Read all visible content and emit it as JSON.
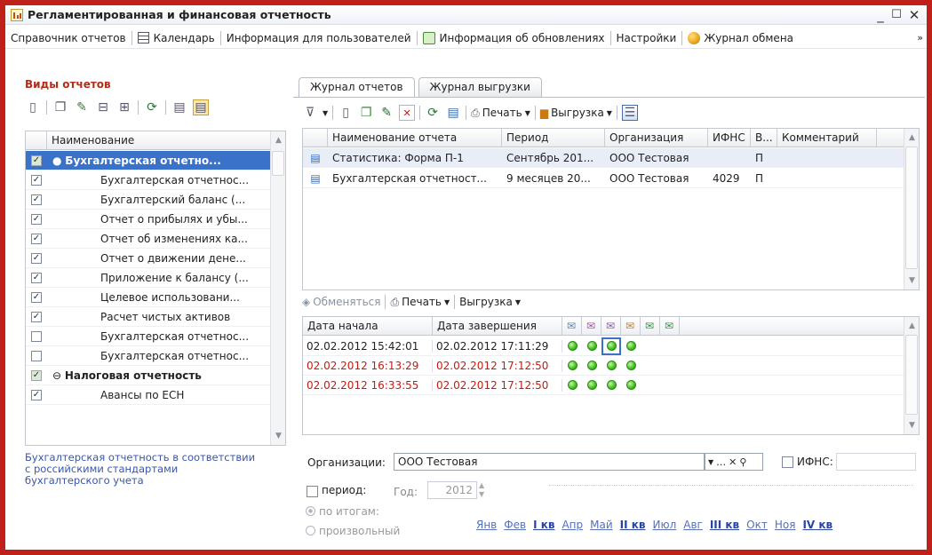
{
  "window": {
    "title": "Регламентированная и финансовая отчетность",
    "min_glyph": "_",
    "close_glyph": "✕"
  },
  "menu": {
    "items": [
      "Справочник отчетов",
      "Календарь",
      "Информация для пользователей",
      "Информация об обновлениях",
      "Настройки",
      "Журнал обмена"
    ],
    "more": "»"
  },
  "left": {
    "title": "Виды отчетов",
    "column": "Наименование",
    "rows": [
      {
        "label": "Бухгалтерская отчетно...",
        "level": 0,
        "checked": true,
        "group": true,
        "selected": true
      },
      {
        "label": "Бухгалтерская отчетнос...",
        "level": 1,
        "checked": true
      },
      {
        "label": "Бухгалтерский баланс (...",
        "level": 1,
        "checked": true
      },
      {
        "label": "Отчет о прибылях и убы...",
        "level": 1,
        "checked": true
      },
      {
        "label": "Отчет об изменениях ка...",
        "level": 1,
        "checked": true
      },
      {
        "label": "Отчет о движении дене...",
        "level": 1,
        "checked": true
      },
      {
        "label": "Приложение к балансу (...",
        "level": 1,
        "checked": true
      },
      {
        "label": "Целевое использовани...",
        "level": 1,
        "checked": true
      },
      {
        "label": "Расчет чистых активов",
        "level": 1,
        "checked": true
      },
      {
        "label": "Бухгалтерская отчетнос...",
        "level": 1,
        "checked": false
      },
      {
        "label": "Бухгалтерская отчетнос...",
        "level": 1,
        "checked": false
      },
      {
        "label": "Налоговая отчетность",
        "level": 0,
        "checked": true,
        "group": true
      },
      {
        "label": "Авансы по ЕСН",
        "level": 1,
        "checked": true
      }
    ],
    "note": "Бухгалтерская отчетность в соответствии с российскими стандартами бухгалтерского учета"
  },
  "tabs": [
    "Журнал отчетов",
    "Журнал выгрузки"
  ],
  "journal": {
    "toolbar": {
      "print": "Печать",
      "export": "Выгрузка"
    },
    "columns": [
      "Наименование отчета",
      "Период",
      "Организация",
      "ИФНС",
      "В...",
      "Комментарий"
    ],
    "rows": [
      {
        "name": "Статистика: Форма П-1",
        "period": "Сентябрь 201...",
        "org": "ООО Тестовая",
        "ifns": "",
        "v": "П",
        "comment": ""
      },
      {
        "name": "Бухгалтерская отчетност...",
        "period": "9 месяцев 20...",
        "org": "ООО Тестовая",
        "ifns": "4029",
        "v": "П",
        "comment": ""
      }
    ]
  },
  "exchange": {
    "toolbar": {
      "exchange": "Обменяться",
      "print": "Печать",
      "export": "Выгрузка"
    },
    "columns": [
      "Дата начала",
      "Дата завершения"
    ],
    "rows": [
      {
        "start": "02.02.2012 15:42:01",
        "end": "02.02.2012 17:11:29",
        "red": false,
        "dots": 4
      },
      {
        "start": "02.02.2012 16:13:29",
        "end": "02.02.2012 17:12:50",
        "red": true,
        "dots": 4
      },
      {
        "start": "02.02.2012 16:33:55",
        "end": "02.02.2012 17:12:50",
        "red": true,
        "dots": 4
      }
    ]
  },
  "bottom": {
    "org_label": "Организации:",
    "org_value": "ООО Тестовая",
    "ifns_label": "ИФНС:",
    "period_label": "период:",
    "year_label": "Год:",
    "year_value": "2012",
    "radio_total": "по итогам:",
    "radio_custom": "произвольный",
    "months": [
      {
        "t": "Янв",
        "q": false
      },
      {
        "t": "Фев",
        "q": false
      },
      {
        "t": "I кв",
        "q": true
      },
      {
        "t": "Апр",
        "q": false
      },
      {
        "t": "Май",
        "q": false
      },
      {
        "t": "II кв",
        "q": true
      },
      {
        "t": "Июл",
        "q": false
      },
      {
        "t": "Авг",
        "q": false
      },
      {
        "t": "III кв",
        "q": true
      },
      {
        "t": "Окт",
        "q": false
      },
      {
        "t": "Ноя",
        "q": false
      },
      {
        "t": "IV кв",
        "q": true
      }
    ]
  }
}
